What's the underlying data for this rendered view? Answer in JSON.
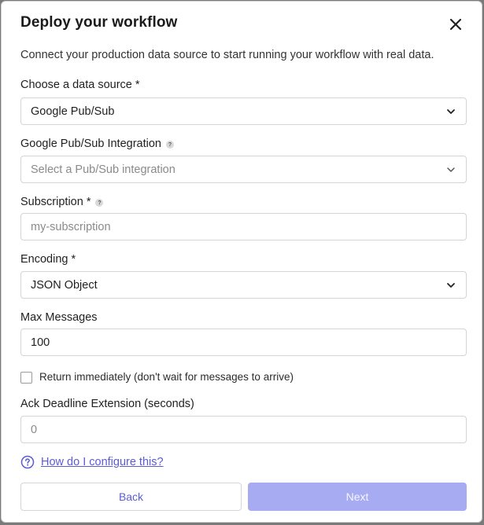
{
  "dialog": {
    "title": "Deploy your workflow",
    "subtitle": "Connect your production data source to start running your workflow with real data."
  },
  "icons": {
    "close": "close-icon",
    "chevron": "chevron-down-icon",
    "help": "help-circle-icon",
    "help_small": "question-icon"
  },
  "fields": {
    "data_source": {
      "label": "Choose a data source *",
      "value": "Google Pub/Sub"
    },
    "integration": {
      "label": "Google Pub/Sub Integration",
      "help": "?",
      "placeholder": "Select a Pub/Sub integration"
    },
    "subscription": {
      "label": "Subscription *",
      "help": "?",
      "placeholder": "my-subscription"
    },
    "encoding": {
      "label": "Encoding *",
      "value": "JSON Object"
    },
    "max_messages": {
      "label": "Max Messages",
      "value": "100"
    },
    "return_immediately": {
      "label": "Return immediately (don't wait for messages to arrive)",
      "checked": false
    },
    "ack_deadline": {
      "label": "Ack Deadline Extension (seconds)",
      "placeholder": "0"
    }
  },
  "help_link": "How do I configure this?",
  "buttons": {
    "back": "Back",
    "next": "Next"
  },
  "colors": {
    "accent": "#5b5bd6",
    "next_disabled": "#a6abf2",
    "border": "#d4d4d4"
  }
}
